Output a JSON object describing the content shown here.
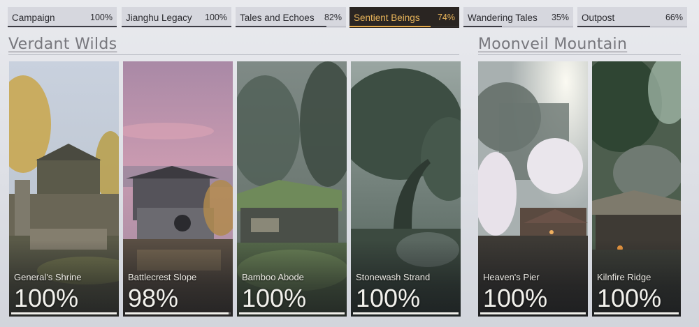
{
  "tabs": [
    {
      "label": "Campaign",
      "percent": "100%",
      "progress": 1.0,
      "active": false
    },
    {
      "label": "Jianghu Legacy",
      "percent": "100%",
      "progress": 1.0,
      "active": false
    },
    {
      "label": "Tales and Echoes",
      "percent": "82%",
      "progress": 0.82,
      "active": false
    },
    {
      "label": "Sentient Beings",
      "percent": "74%",
      "progress": 0.74,
      "active": true
    },
    {
      "label": "Wandering Tales",
      "percent": "35%",
      "progress": 0.35,
      "active": false
    },
    {
      "label": "Outpost",
      "percent": "66%",
      "progress": 0.66,
      "active": false
    }
  ],
  "regions": [
    {
      "title": "Verdant Wilds"
    },
    {
      "title": "Moonveil Mountain"
    }
  ],
  "locations": [
    {
      "name": "General's Shrine",
      "percent": "100%",
      "progress": 1.0,
      "scene": "shrine"
    },
    {
      "name": "Battlecrest Slope",
      "percent": "98%",
      "progress": 0.98,
      "scene": "slope"
    },
    {
      "name": "Bamboo Abode",
      "percent": "100%",
      "progress": 1.0,
      "scene": "abode"
    },
    {
      "name": "Stonewash Strand",
      "percent": "100%",
      "progress": 1.0,
      "scene": "strand"
    },
    {
      "name": "Heaven's Pier",
      "percent": "100%",
      "progress": 1.0,
      "scene": "pier"
    },
    {
      "name": "Kilnfire Ridge",
      "percent": "100%",
      "progress": 1.0,
      "scene": "ridge"
    }
  ],
  "colors": {
    "active_tab_bg": "#2a2522",
    "active_tab_accent": "#e3a94a",
    "region_title": "#77777d"
  }
}
